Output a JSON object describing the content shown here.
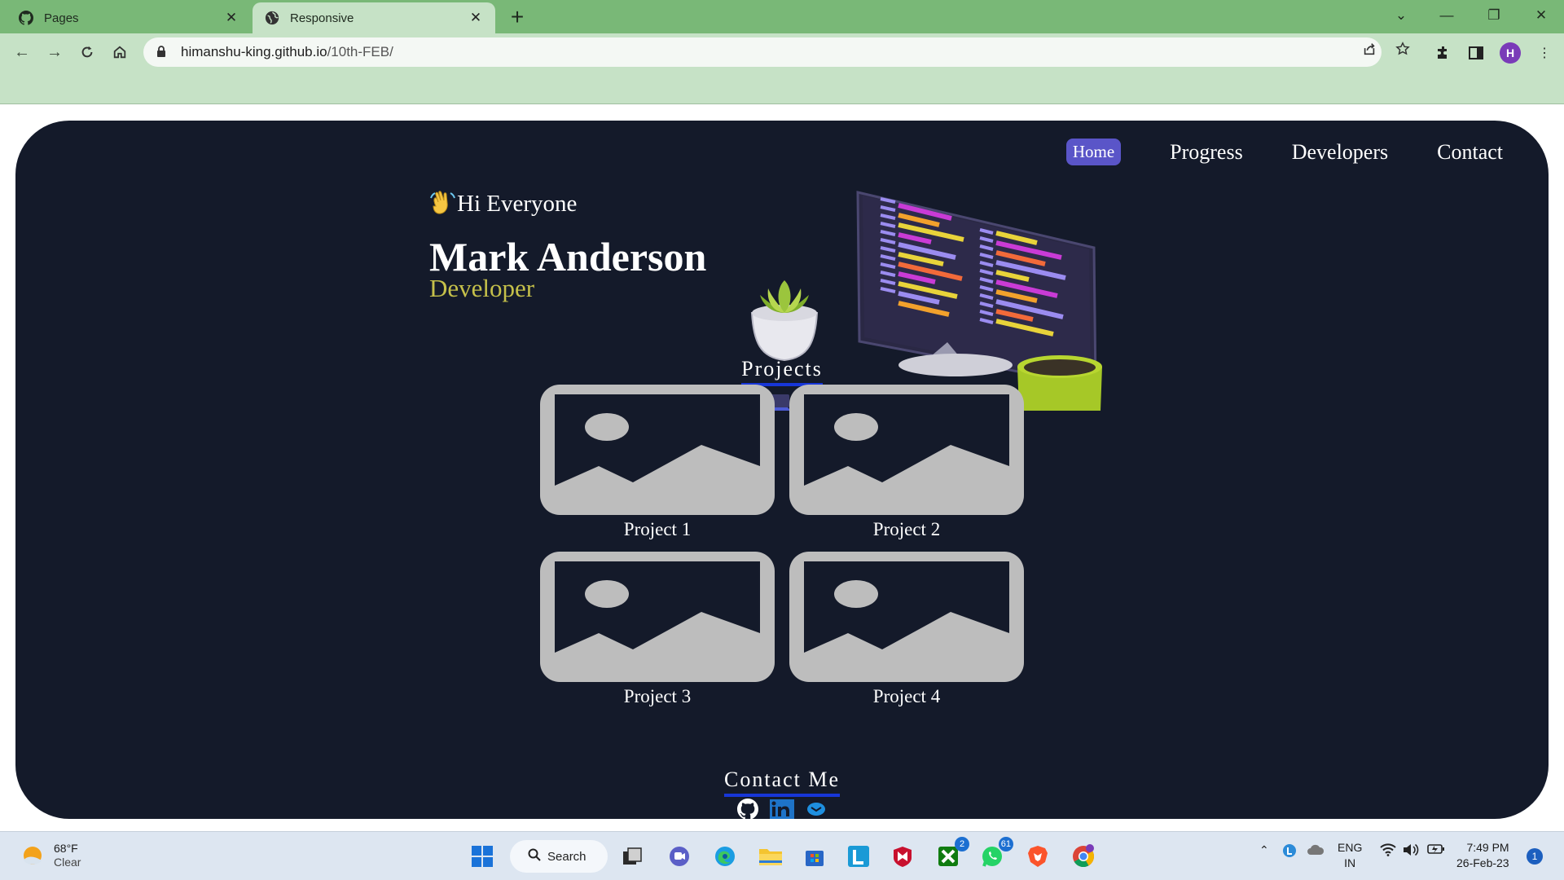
{
  "browser": {
    "tabs": [
      {
        "title": "Pages",
        "icon": "github-icon",
        "active": false
      },
      {
        "title": "Responsive",
        "icon": "globe-icon",
        "active": true
      }
    ],
    "url_host": "himanshu-king.github.io",
    "url_path": "/10th-FEB/",
    "profile_initial": "H",
    "colors": {
      "tabbar": "#79b877",
      "toolbar": "#c6e2c6"
    }
  },
  "site": {
    "nav": {
      "items": [
        "Home",
        "Progress",
        "Developers",
        "Contact"
      ],
      "active": "Home"
    },
    "hero": {
      "greeting": "Hi Everyone",
      "name": "Mark Anderson",
      "role": "Developer"
    },
    "projects": {
      "title": "Projects",
      "items": [
        "Project 1",
        "Project 2",
        "Project 3",
        "Project 4"
      ]
    },
    "contact": {
      "title": "Contact Me",
      "socials": [
        "github-icon",
        "linkedin-icon",
        "email-icon"
      ]
    },
    "colors": {
      "background": "#141a2a",
      "accent": "#5a55c8",
      "role": "#c5c04a",
      "underline": "#1736d8",
      "placeholder": "#bdbdbd"
    }
  },
  "taskbar": {
    "weather_temp": "68°F",
    "weather_condition": "Clear",
    "search_label": "Search",
    "badges": {
      "xbox": "2",
      "whatsapp": "61"
    },
    "language": "ENG",
    "region": "IN",
    "time": "7:49 PM",
    "date": "26-Feb-23",
    "notification_count": "1"
  }
}
